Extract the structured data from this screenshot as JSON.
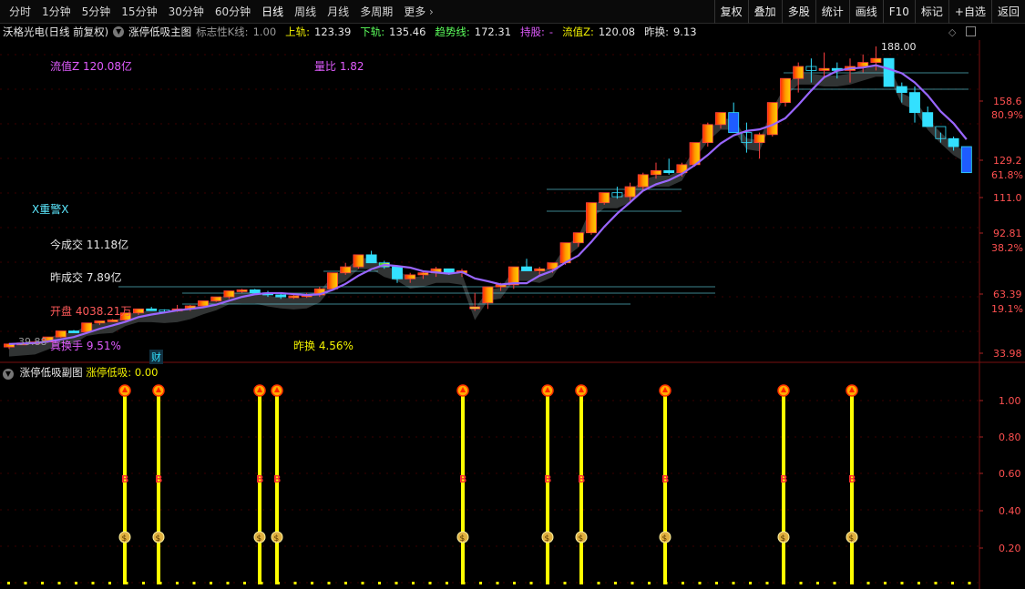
{
  "toolbar": {
    "periods": [
      "分时",
      "1分钟",
      "5分钟",
      "15分钟",
      "30分钟",
      "60分钟",
      "日线",
      "周线",
      "月线",
      "多周期",
      "更多"
    ],
    "active_period": "日线",
    "actions": [
      "复权",
      "叠加",
      "多股",
      "统计",
      "画线",
      "F10",
      "标记",
      "+自选",
      "返回"
    ]
  },
  "main_info": {
    "stock": "沃格光电(日线 前复权)",
    "indicator": "涨停低吸主图",
    "flag_label": "标志性K线:",
    "flag_value": "1.00",
    "upper_label": "上轨:",
    "upper_value": "123.39",
    "lower_label": "下轨:",
    "lower_value": "135.46",
    "trend_label": "趋势线:",
    "trend_value": "172.31",
    "hold_label": "持股:",
    "hold_value": "-",
    "float_label": "流值Z:",
    "float_value": "120.08",
    "prev_turn_label": "昨换:",
    "prev_turn_value": "9.13"
  },
  "overlays": {
    "float_value": "流值Z 120.08亿",
    "volume_ratio": "量比 1.82",
    "warning": "X重警X",
    "today_turnover": "今成交 11.18亿",
    "yesterday_turnover": "昨成交 7.89亿",
    "open_volume": "开盘 4038.21万",
    "real_turnover": "真换手 9.51%",
    "yesterday_turnover_rate": "昨换 4.56%",
    "low_label": "39.88",
    "high_label": "188.00",
    "finance_badge": "财"
  },
  "price_axis": {
    "ticks": [
      "158.6",
      "129.2",
      "111.0",
      "92.81",
      "63.39",
      "33.98"
    ],
    "percents": [
      "80.9%",
      "61.8%",
      "38.2%",
      "19.1%"
    ]
  },
  "sub_info": {
    "indicator": "涨停低吸副图",
    "value_label": "涨停低吸:",
    "value": "0.00"
  },
  "sub_axis": {
    "ticks": [
      "1.00",
      "0.80",
      "0.60",
      "0.40",
      "0.20"
    ]
  },
  "signal_markers": {
    "B": "B",
    "money": "$"
  },
  "colors": {
    "up_red": "#ff3030",
    "ma_purple": "#9966ff",
    "signal_yellow": "#ffff00",
    "cyan": "#33e0ff",
    "blue_bar": "#1e5cff"
  },
  "chart_data": {
    "type": "candlestick",
    "x_count": 75,
    "ylim": [
      33.98,
      188.0
    ],
    "candles": [
      [
        38,
        40,
        37,
        39.5
      ],
      [
        39.5,
        40.2,
        39,
        40
      ],
      [
        40,
        41,
        39.5,
        40.5
      ],
      [
        40.5,
        43,
        40,
        43
      ],
      [
        43,
        46,
        42.5,
        46
      ],
      [
        46,
        46.5,
        45,
        45.5
      ],
      [
        45.5,
        50,
        45,
        50
      ],
      [
        50,
        51,
        49,
        51
      ],
      [
        51,
        52,
        50.5,
        51.5
      ],
      [
        51.5,
        55,
        51,
        55
      ],
      [
        55,
        57,
        54,
        57
      ],
      [
        57,
        58,
        56,
        56.5
      ],
      [
        56.5,
        56.8,
        55.5,
        56
      ],
      [
        56,
        59,
        55.5,
        57
      ],
      [
        57,
        59,
        56,
        58.5
      ],
      [
        58.5,
        61,
        58,
        61
      ],
      [
        61,
        63,
        60.5,
        63
      ],
      [
        63,
        66,
        62,
        66
      ],
      [
        66,
        67,
        65,
        66.5
      ],
      [
        66.5,
        67,
        64,
        65
      ],
      [
        65,
        66,
        63,
        64
      ],
      [
        64,
        65,
        62,
        63
      ],
      [
        63,
        64,
        62,
        63.5
      ],
      [
        63.5,
        65,
        62.5,
        64
      ],
      [
        64,
        68,
        63,
        67
      ],
      [
        67,
        75,
        66,
        75
      ],
      [
        75,
        80,
        74,
        78
      ],
      [
        78,
        84,
        77,
        84
      ],
      [
        84,
        86,
        80,
        80
      ],
      [
        80,
        81,
        77,
        78
      ],
      [
        78,
        78,
        70,
        72
      ],
      [
        72,
        75,
        70,
        74
      ],
      [
        74,
        76,
        72,
        75
      ],
      [
        75,
        78,
        73,
        77
      ],
      [
        77,
        76,
        74,
        75
      ],
      [
        75,
        77,
        73,
        76
      ],
      [
        58,
        65,
        56,
        58
      ],
      [
        60,
        68,
        57,
        68
      ],
      [
        68,
        70,
        66,
        69
      ],
      [
        69,
        78,
        67,
        78
      ],
      [
        78,
        82,
        76,
        76
      ],
      [
        76,
        78,
        74,
        77
      ],
      [
        77,
        80,
        75,
        80
      ],
      [
        80,
        90,
        79,
        90
      ],
      [
        90,
        95,
        88,
        95
      ],
      [
        95,
        110,
        94,
        110
      ],
      [
        110,
        115,
        109,
        115
      ],
      [
        115,
        118,
        112,
        113
      ],
      [
        113,
        120,
        111,
        118
      ],
      [
        118,
        125,
        116,
        124
      ],
      [
        124,
        130,
        122,
        126
      ],
      [
        126,
        132,
        124,
        125
      ],
      [
        125,
        130,
        123,
        129
      ],
      [
        129,
        140,
        128,
        140
      ],
      [
        140,
        150,
        138,
        149
      ],
      [
        149,
        155,
        147,
        155
      ],
      [
        155,
        160,
        145,
        145
      ],
      [
        145,
        150,
        135,
        140
      ],
      [
        140,
        145,
        132,
        144
      ],
      [
        144,
        160,
        143,
        160
      ],
      [
        160,
        172,
        158,
        172
      ],
      [
        172,
        180,
        165,
        178
      ],
      [
        178,
        182,
        170,
        176
      ],
      [
        176,
        185,
        172,
        177
      ],
      [
        177,
        180,
        172,
        176
      ],
      [
        176,
        182,
        170,
        178
      ],
      [
        178,
        184,
        175,
        180
      ],
      [
        180,
        188,
        176,
        182
      ],
      [
        182,
        180,
        168,
        168
      ],
      [
        168,
        170,
        160,
        165
      ],
      [
        165,
        168,
        150,
        155
      ],
      [
        155,
        158,
        148,
        148
      ],
      [
        148,
        145,
        140,
        142
      ],
      [
        142,
        143,
        136,
        138
      ],
      [
        138,
        137,
        125,
        125
      ]
    ],
    "signal_columns": [
      6,
      8,
      14,
      15,
      24,
      28,
      30,
      35,
      40,
      44
    ]
  }
}
